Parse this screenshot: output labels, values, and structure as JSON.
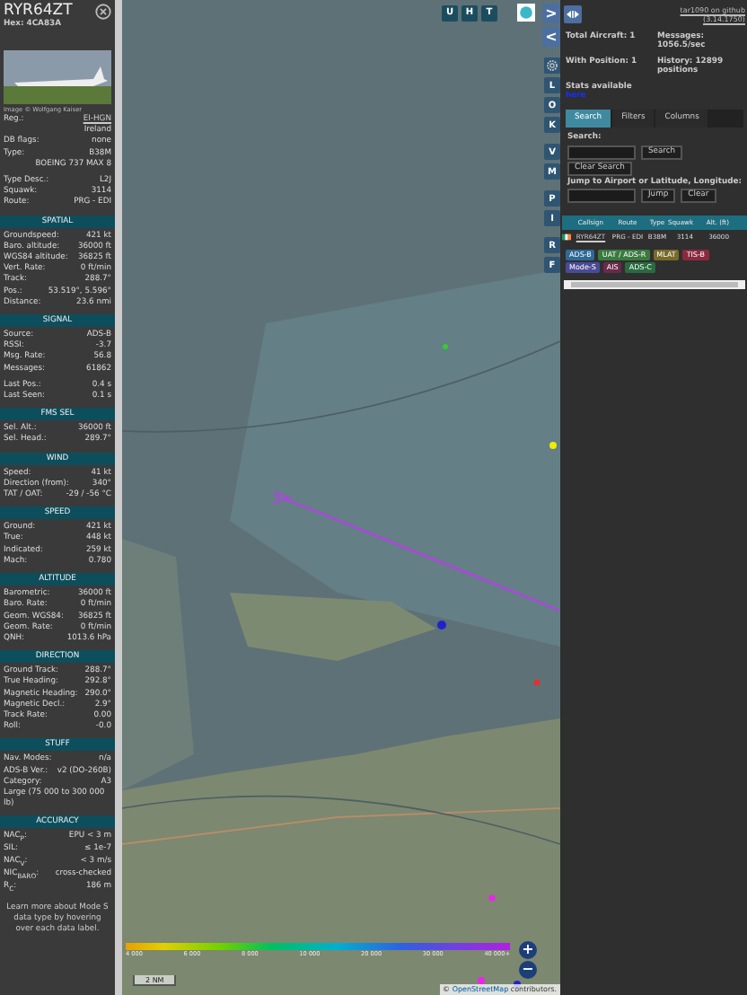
{
  "aircraft_panel": {
    "callsign": "RYR64ZT",
    "hex_label": "Hex:",
    "hex": "4CA83A",
    "photo_caption": "Image © Wolfgang Kaiser",
    "info_groups": [
      [
        {
          "kind": "pair",
          "label": "Reg.:",
          "value": "EI-HGN",
          "link": true
        },
        {
          "kind": "value",
          "value": "Ireland"
        },
        {
          "kind": "pair",
          "label": "DB flags:",
          "value": "none"
        },
        {
          "kind": "pair",
          "label": "Type:",
          "value": "B38M"
        },
        {
          "kind": "value",
          "value": "BOEING 737 MAX 8"
        }
      ],
      [
        {
          "kind": "pair",
          "label": "Type Desc.:",
          "value": "L2J"
        },
        {
          "kind": "pair",
          "label": "Squawk:",
          "value": "3114"
        },
        {
          "kind": "pair",
          "label": "Route:",
          "value": "PRG - EDI"
        }
      ]
    ],
    "sections": [
      {
        "title": "SPATIAL",
        "groups": [
          [
            {
              "kind": "pair",
              "label": "Groundspeed:",
              "value": "421 kt"
            },
            {
              "kind": "pair",
              "label": "Baro. altitude:",
              "value": "36000 ft"
            },
            {
              "kind": "pair",
              "label": "WGS84 altitude:",
              "value": "36825 ft"
            },
            {
              "kind": "pair",
              "label": "Vert. Rate:",
              "value": "0 ft/min"
            },
            {
              "kind": "pair",
              "label": "Track:",
              "value": "288.7°"
            },
            {
              "kind": "pair",
              "label": "Pos.:",
              "value": "53.519°, 5.596°"
            },
            {
              "kind": "pair",
              "label": "Distance:",
              "value": "23.6 nmi"
            }
          ]
        ]
      },
      {
        "title": "SIGNAL",
        "groups": [
          [
            {
              "kind": "pair",
              "label": "Source:",
              "value": "ADS-B"
            },
            {
              "kind": "pair",
              "label": "RSSI:",
              "value": "-3.7"
            },
            {
              "kind": "pair",
              "label": "Msg. Rate:",
              "value": "56.8"
            },
            {
              "kind": "pair",
              "label": "Messages:",
              "value": "61862"
            }
          ],
          [
            {
              "kind": "pair",
              "label": "Last Pos.:",
              "value": "0.4 s"
            },
            {
              "kind": "pair",
              "label": "Last Seen:",
              "value": "0.1 s"
            }
          ]
        ]
      },
      {
        "title": "FMS SEL",
        "groups": [
          [
            {
              "kind": "pair",
              "label": "Sel. Alt.:",
              "value": "36000 ft"
            },
            {
              "kind": "pair",
              "label": "Sel. Head.:",
              "value": "289.7°"
            }
          ]
        ]
      },
      {
        "title": "WIND",
        "groups": [
          [
            {
              "kind": "pair",
              "label": "Speed:",
              "value": "41 kt"
            },
            {
              "kind": "pair",
              "label": "Direction (from):",
              "value": "340°"
            },
            {
              "kind": "pair",
              "label": "TAT / OAT:",
              "value": "-29 / -56 °C"
            }
          ]
        ]
      },
      {
        "title": "SPEED",
        "groups": [
          [
            {
              "kind": "pair",
              "label": "Ground:",
              "value": "421 kt"
            },
            {
              "kind": "pair",
              "label": "True:",
              "value": "448 kt"
            },
            {
              "kind": "pair",
              "label": "Indicated:",
              "value": "259 kt"
            },
            {
              "kind": "pair",
              "label": "Mach:",
              "value": "0.780"
            }
          ]
        ]
      },
      {
        "title": "ALTITUDE",
        "groups": [
          [
            {
              "kind": "pair",
              "label": "Barometric:",
              "value": "36000 ft"
            },
            {
              "kind": "pair",
              "label": "Baro. Rate:",
              "value": "0 ft/min"
            },
            {
              "kind": "pair",
              "label": "Geom. WGS84:",
              "value": "36825 ft"
            },
            {
              "kind": "pair",
              "label": "Geom. Rate:",
              "value": "0 ft/min"
            },
            {
              "kind": "pair",
              "label": "QNH:",
              "value": "1013.6 hPa"
            }
          ]
        ]
      },
      {
        "title": "DIRECTION",
        "groups": [
          [
            {
              "kind": "pair",
              "label": "Ground Track:",
              "value": "288.7°"
            },
            {
              "kind": "pair",
              "label": "True Heading:",
              "value": "292.8°"
            },
            {
              "kind": "pair",
              "label": "Magnetic Heading:",
              "value": "290.0°"
            },
            {
              "kind": "pair",
              "label": "Magnetic Decl.:",
              "value": "2.9°"
            },
            {
              "kind": "pair",
              "label": "Track Rate:",
              "value": "0.00"
            },
            {
              "kind": "pair",
              "label": "Roll:",
              "value": "-0.0"
            }
          ]
        ]
      },
      {
        "title": "STUFF",
        "groups": [
          [
            {
              "kind": "pair",
              "label": "Nav. Modes:",
              "value": "n/a"
            },
            {
              "kind": "pair",
              "label": "ADS-B Ver.:",
              "value": "v2 (DO-260B)"
            },
            {
              "kind": "pair",
              "label": "Category:",
              "value": "A3"
            },
            {
              "kind": "label",
              "label": "Large (75 000 to 300 000 lb)"
            }
          ]
        ]
      },
      {
        "title": "ACCURACY",
        "groups": [
          [
            {
              "kind": "pair",
              "label": "NAC$_{P}$:",
              "value": "EPU < 3 m"
            },
            {
              "kind": "pair",
              "label": "SIL:",
              "value": "≤ 1e-7"
            },
            {
              "kind": "pair",
              "label": "NAC$_{V}$:",
              "value": "< 3 m/s"
            },
            {
              "kind": "pair",
              "label": "NIC$_{BARO}$:",
              "value": "cross-checked"
            },
            {
              "kind": "pair",
              "label": "R$_{C}$:",
              "value": "186 m"
            }
          ]
        ]
      }
    ],
    "footer": "Learn more about Mode S data type by hovering over each data label."
  },
  "map": {
    "top_buttons": [
      {
        "label": "U"
      },
      {
        "label": "H"
      },
      {
        "label": "T"
      }
    ],
    "side_groups": [
      [
        {
          "kind": "arrow",
          "label": ">"
        },
        {
          "kind": "arrow",
          "label": "<"
        }
      ],
      [
        {
          "kind": "gear"
        },
        {
          "kind": "letter",
          "label": "L"
        },
        {
          "kind": "letter",
          "label": "O"
        },
        {
          "kind": "letter",
          "label": "K"
        }
      ],
      [
        {
          "kind": "letter",
          "label": "V"
        },
        {
          "kind": "letter",
          "label": "M"
        }
      ],
      [
        {
          "kind": "letter",
          "label": "P"
        },
        {
          "kind": "letter",
          "label": "I"
        }
      ],
      [
        {
          "kind": "letter",
          "label": "R"
        },
        {
          "kind": "letter",
          "label": "F"
        }
      ]
    ],
    "altitude_legend": [
      "4 000",
      "6 000",
      "8 000",
      "10 000",
      "20 000",
      "30 000",
      "40 000+"
    ],
    "scale": "2 NM",
    "zoom_in": "+",
    "zoom_out": "−",
    "attribution": {
      "prefix": "©",
      "link": "OpenStreetMap",
      "suffix": "contributors."
    }
  },
  "side_panel": {
    "version_link": "tar1090 on github (3.14.1750)",
    "stats": [
      {
        "label": "Total Aircraft: 1"
      },
      {
        "label": "Messages: 1056.5/sec"
      },
      {
        "label": "With Position: 1"
      },
      {
        "label": "History: 12899 positions"
      }
    ],
    "stats_note": "Stats available",
    "stats_link": "here",
    "tabs": [
      {
        "label": "Search",
        "selected": true
      },
      {
        "label": "Filters",
        "selected": false
      },
      {
        "label": "Columns",
        "selected": false
      }
    ],
    "search_label": "Search:",
    "search_button": "Search",
    "clear_search_button": "Clear Search",
    "jump_label": "Jump to Airport or Latitude, Longitude:",
    "jump_button": "Jump",
    "clear_button": "Clear",
    "table": {
      "columns": [
        "Callsign",
        "Route",
        "Type",
        "Squawk",
        "Alt. (ft)"
      ],
      "rows": [
        {
          "cells": [
            "RYR64ZT",
            "PRG - EDI",
            "B38M",
            "3114",
            "36000"
          ]
        }
      ]
    },
    "source_tags": [
      {
        "label": "ADS-B",
        "color": "#2f6a96"
      },
      {
        "label": "UAT / ADS-R",
        "color": "#3a7a40"
      },
      {
        "label": "MLAT",
        "color": "#7a6a2a"
      },
      {
        "label": "TIS-B",
        "color": "#8a2a3e"
      },
      {
        "label": "Mode-S",
        "color": "#4a4a96"
      },
      {
        "label": "AIS",
        "color": "#6a2a4a"
      },
      {
        "label": "ADS-C",
        "color": "#2a6a40"
      }
    ]
  }
}
